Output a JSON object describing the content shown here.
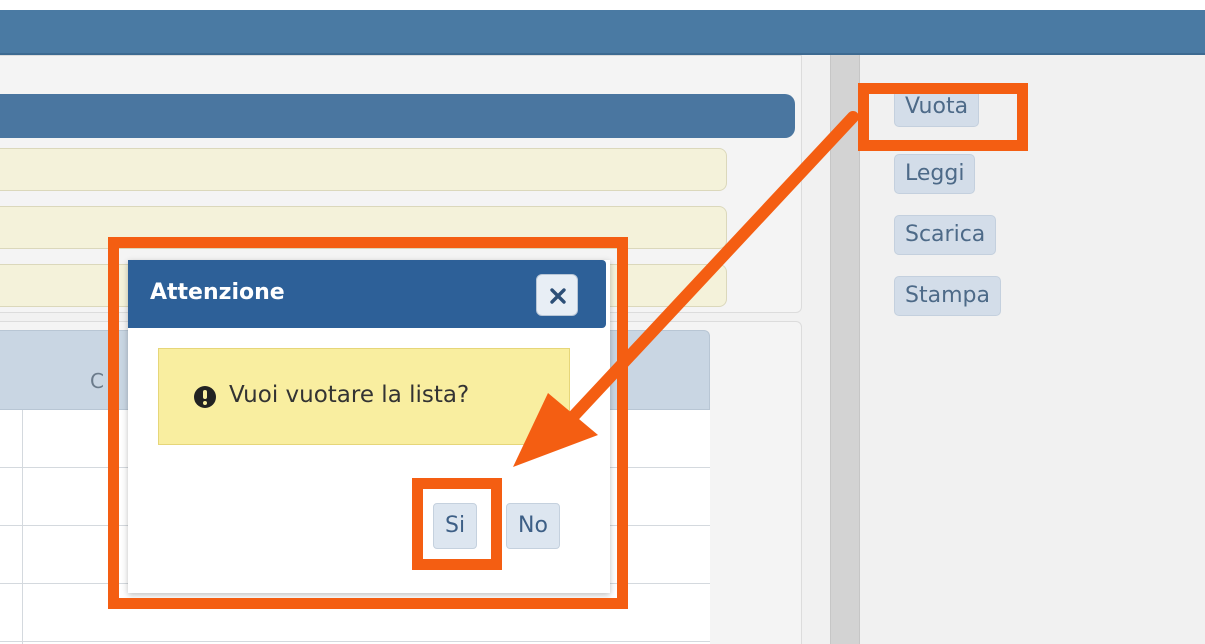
{
  "side_panel": {
    "buttons": [
      {
        "label": "Vuota"
      },
      {
        "label": "Leggi"
      },
      {
        "label": "Scarica"
      },
      {
        "label": "Stampa"
      }
    ]
  },
  "grid": {
    "partial_header_text": "C"
  },
  "dialog": {
    "title": "Attenzione",
    "message": "Vuoi vuotare la lista?",
    "close_icon": "close-icon",
    "warning_icon": "exclamation-circle-icon",
    "yes_label": "Si",
    "no_label": "No"
  },
  "annotations": {
    "highlight_color": "#f45e12",
    "highlights": [
      "dialog",
      "vuota-button",
      "si-button"
    ],
    "arrow": "from-vuota-to-si"
  }
}
